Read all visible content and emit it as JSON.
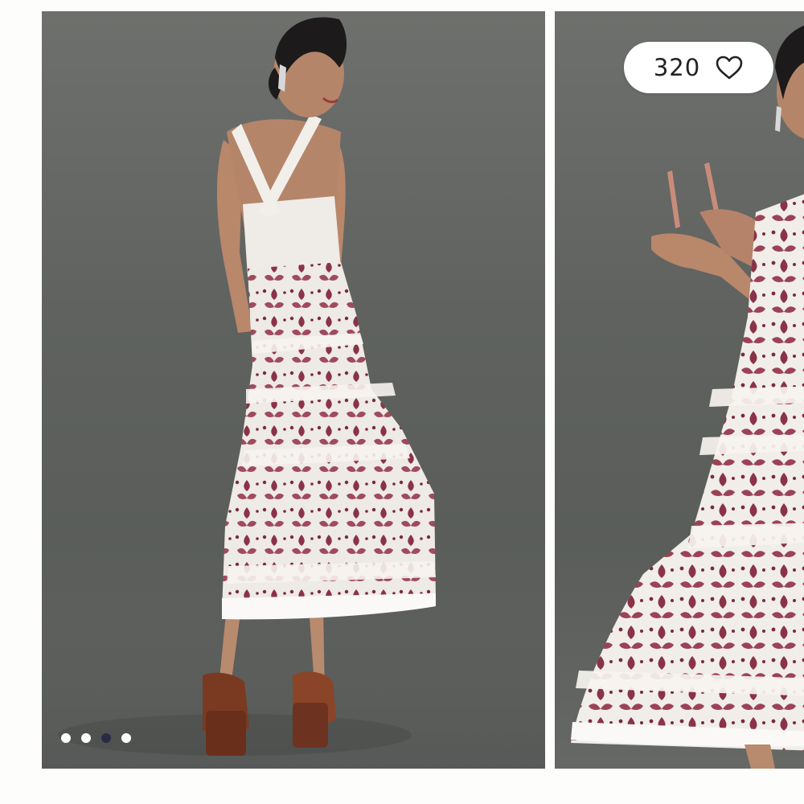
{
  "gallery": {
    "likes": {
      "count": "320",
      "icon": "heart-outline-icon"
    },
    "pagination": {
      "total": 4,
      "active_index": 2
    },
    "slides": [
      {
        "subject": "model-back-view-embroidered-midi-dress"
      },
      {
        "subject": "model-front-view-holding-sunglasses"
      }
    ],
    "colors": {
      "backdrop": "#5f625f",
      "dress_white": "#eeeae6",
      "embroidery": "#7a2a3e",
      "shoe": "#7a3a22",
      "dot_inactive": "#ffffff",
      "dot_active": "#2a2c44"
    }
  }
}
